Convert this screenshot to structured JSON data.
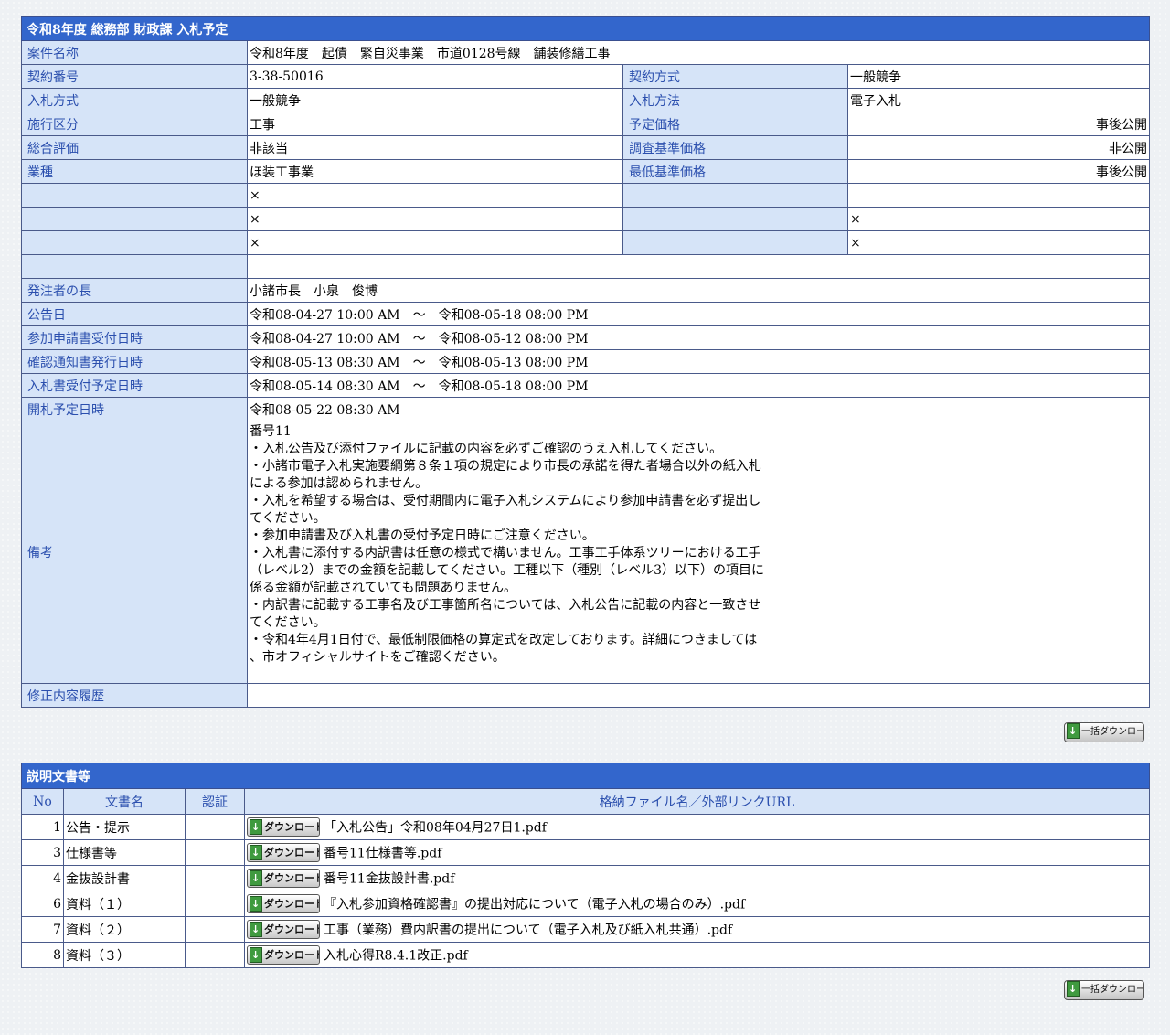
{
  "header": {
    "title": "令和8年度 総務部 財政課 入札予定"
  },
  "fields": {
    "case_name_label": "案件名称",
    "case_name": "令和8年度　起債　緊自災事業　市道0128号線　舗装修繕工事",
    "contract_no_label": "契約番号",
    "contract_no": "3-38-50016",
    "contract_method_label": "契約方式",
    "contract_method": "一般競争",
    "bid_type_label": "入札方式",
    "bid_type": "一般競争",
    "bid_method_label": "入札方法",
    "bid_method": "電子入札",
    "work_class_label": "施行区分",
    "work_class": "工事",
    "planned_price_label": "予定価格",
    "planned_price": "事後公開",
    "overall_eval_label": "総合評価",
    "overall_eval": "非該当",
    "survey_price_label": "調査基準価格",
    "survey_price": "非公開",
    "industry_label": "業種",
    "industry": "ほ装工事業",
    "min_price_label": "最低基準価格",
    "min_price": "事後公開",
    "x_mark": "×",
    "orderer_label": "発注者の長",
    "orderer": "小諸市長　小泉　俊博",
    "announce_date_label": "公告日",
    "announce_date": "令和08-04-27 10:00 AM　～　令和08-05-18 08:00 PM",
    "apply_period_label": "参加申請書受付日時",
    "apply_period": "令和08-04-27 10:00 AM　～　令和08-05-12 08:00 PM",
    "confirm_issue_label": "確認通知書発行日時",
    "confirm_issue": "令和08-05-13 08:30 AM　～　令和08-05-13 08:00 PM",
    "bid_accept_label": "入札書受付予定日時",
    "bid_accept": "令和08-05-14 08:30 AM　～　令和08-05-18 08:00 PM",
    "opening_label": "開札予定日時",
    "opening": "令和08-05-22 08:30 AM",
    "remarks_label": "備考",
    "remarks_lines": [
      "番号11",
      "・入札公告及び添付ファイルに記載の内容を必ずご確認のうえ入札してください。",
      "・小諸市電子入札実施要綱第８条１項の規定により市長の承諾を得た者場合以外の紙入札",
      "による参加は認められません。",
      "・入札を希望する場合は、受付期間内に電子入札システムにより参加申請書を必ず提出し",
      "てください。",
      "・参加申請書及び入札書の受付予定日時にご注意ください。",
      "・入札書に添付する内訳書は任意の様式で構いません。工事工手体系ツリーにおける工手",
      "（レベル2）までの金額を記載してください。工種以下（種別（レベル3）以下）の項目に",
      "係る金額が記載されていても問題ありません。",
      "・内訳書に記載する工事名及び工事箇所名については、入札公告に記載の内容と一致させ",
      "てください。",
      "・令和4年4月1日付で、最低制限価格の算定式を改定しております。詳細につきましては",
      "、市オフィシャルサイトをご確認ください。"
    ],
    "revision_label": "修正内容履歴"
  },
  "bulk_download_label": "一括ダウンロード",
  "docs": {
    "title": "説明文書等",
    "col_no": "No",
    "col_name": "文書名",
    "col_cert": "認証",
    "col_file": "格納ファイル名／外部リンクURL",
    "download_label": "ダウンロード",
    "rows": [
      {
        "no": "1",
        "name": "公告・提示",
        "file": "「入札公告」令和08年04月27日1.pdf"
      },
      {
        "no": "3",
        "name": "仕様書等",
        "file": "番号11仕様書等.pdf"
      },
      {
        "no": "4",
        "name": "金抜設計書",
        "file": "番号11金抜設計書.pdf"
      },
      {
        "no": "6",
        "name": "資料（１）",
        "file": "『入札参加資格確認書』の提出対応について（電子入札の場合のみ）.pdf"
      },
      {
        "no": "7",
        "name": "資料（２）",
        "file": "工事（業務）費内訳書の提出について（電子入札及び紙入札共通）.pdf"
      },
      {
        "no": "8",
        "name": "資料（３）",
        "file": "入札心得R8.4.1改正.pdf"
      }
    ]
  }
}
